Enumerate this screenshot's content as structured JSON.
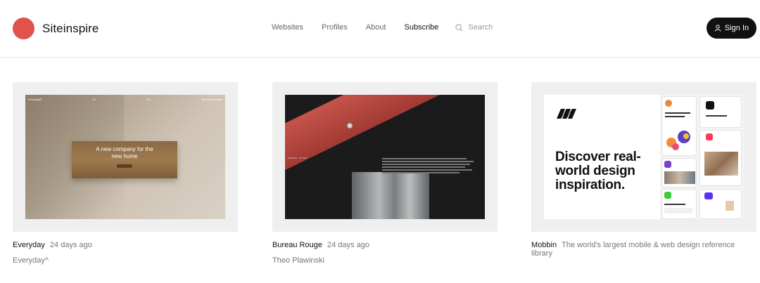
{
  "header": {
    "brand": "Siteinspire",
    "nav": [
      "Websites",
      "Profiles",
      "About",
      "Subscribe"
    ],
    "search_placeholder": "Search",
    "sign_in": "Sign In",
    "colors": {
      "brand": "#e0524b",
      "button": "#111111"
    }
  },
  "cards": [
    {
      "name": "Everyday",
      "age": "24 days ago",
      "subtitle": "Everyday^",
      "preview": {
        "nav_left": "Everyday®",
        "nav_mid1": "Ai",
        "nav_mid2": "OS",
        "nav_right": "Get early access",
        "headline": "A new company for the new home"
      }
    },
    {
      "name": "Bureau Rouge",
      "age": "24 days ago",
      "subtitle": "Theo Plawinski",
      "preview": {
        "label": "BUREAU ROUGE"
      }
    },
    {
      "name": "Mobbin",
      "description": "The world's largest mobile & web design reference library",
      "preview": {
        "headline": "Discover real-world design inspiration."
      }
    }
  ]
}
